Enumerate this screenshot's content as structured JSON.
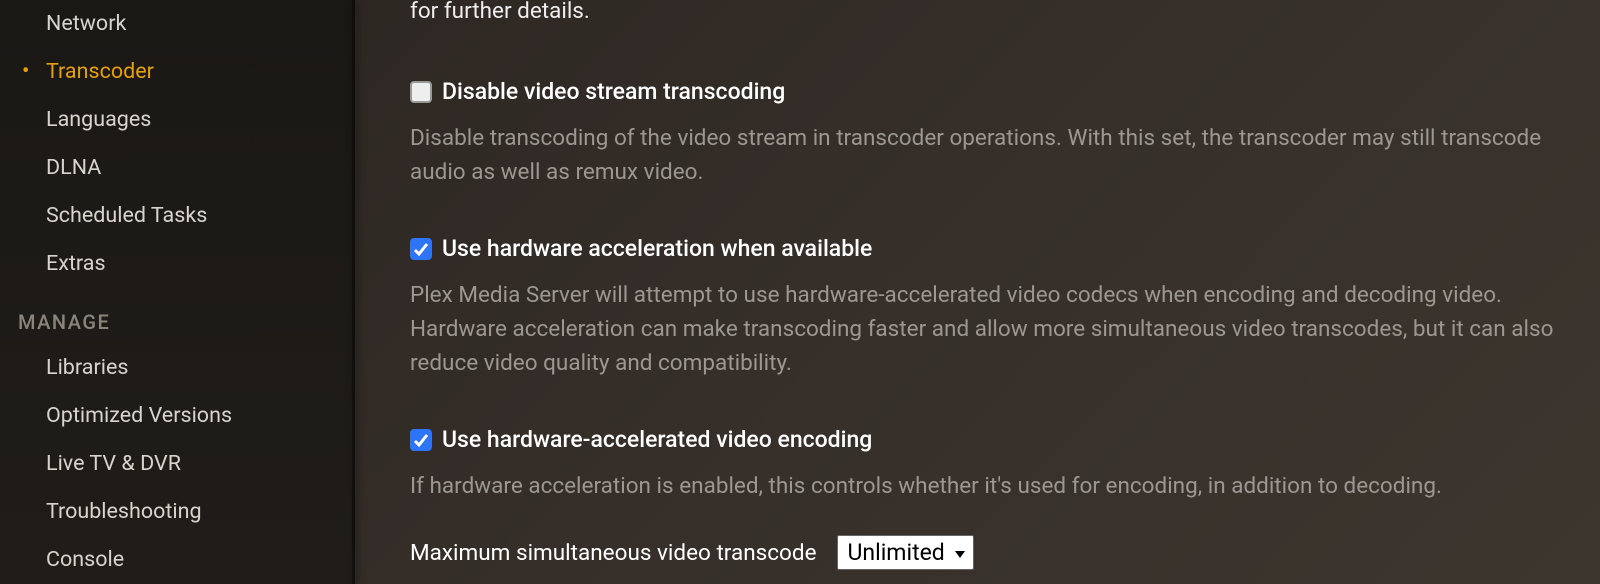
{
  "sidebar": {
    "settings_items": [
      {
        "label": "Network",
        "active": false
      },
      {
        "label": "Transcoder",
        "active": true
      },
      {
        "label": "Languages",
        "active": false
      },
      {
        "label": "DLNA",
        "active": false
      },
      {
        "label": "Scheduled Tasks",
        "active": false
      },
      {
        "label": "Extras",
        "active": false
      }
    ],
    "manage_header": "MANAGE",
    "manage_items": [
      {
        "label": "Libraries"
      },
      {
        "label": "Optimized Versions"
      },
      {
        "label": "Live TV & DVR"
      },
      {
        "label": "Troubleshooting"
      },
      {
        "label": "Console"
      }
    ]
  },
  "main": {
    "intro_fragment": "for further details.",
    "settings": [
      {
        "id": "disable-video-stream-transcoding",
        "label": "Disable video stream transcoding",
        "checked": false,
        "description": "Disable transcoding of the video stream in transcoder operations. With this set, the transcoder may still transcode audio as well as remux video."
      },
      {
        "id": "use-hardware-acceleration",
        "label": "Use hardware acceleration when available",
        "checked": true,
        "description": "Plex Media Server will attempt to use hardware-accelerated video codecs when encoding and decoding video. Hardware acceleration can make transcoding faster and allow more simultaneous video transcodes, but it can also reduce video quality and compatibility."
      },
      {
        "id": "use-hardware-accelerated-encoding",
        "label": "Use hardware-accelerated video encoding",
        "checked": true,
        "description": "If hardware acceleration is enabled, this controls whether it's used for encoding, in addition to decoding."
      }
    ],
    "max_transcode": {
      "label": "Maximum simultaneous video transcode",
      "selected": "Unlimited"
    }
  }
}
